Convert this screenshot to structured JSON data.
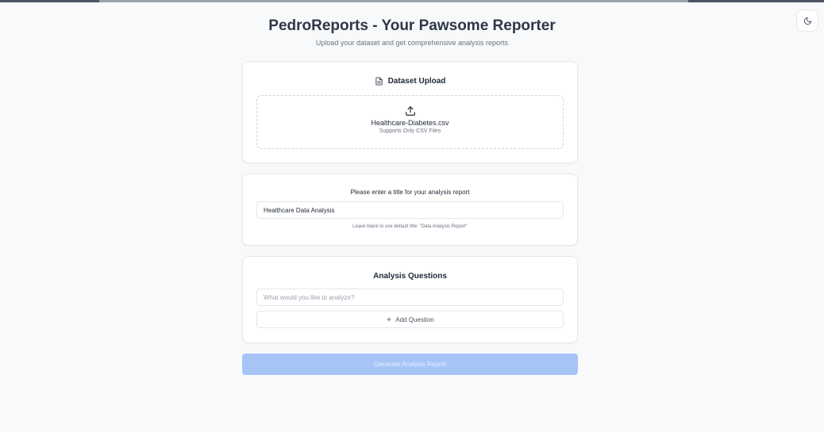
{
  "app": {
    "title": "PedroReports - Your Pawsome Reporter",
    "subtitle": "Upload your dataset and get comprehensive analysis reports"
  },
  "theme_toggle": {
    "icon": "moon-icon"
  },
  "upload": {
    "heading": "Dataset Upload",
    "heading_icon": "file-text-icon",
    "dropzone_icon": "upload-icon",
    "file_name": "Healthcare-Diabetes.csv",
    "hint": "Supports Only CSV Files"
  },
  "report_title": {
    "label": "Please enter a title for your analysis report",
    "value": "Healthcare Data Analysis",
    "help": "Leave blank to use default title: \"Data Analysis Report\""
  },
  "questions": {
    "heading": "Analysis Questions",
    "placeholder": "What would you like to analyze?",
    "add_label": "Add Question",
    "add_icon": "plus-icon"
  },
  "generate": {
    "label": "Generate Analysis Report",
    "disabled": true
  },
  "colors": {
    "page_bg": "#f8f9fb",
    "title_text": "#2d3748",
    "button_disabled_bg": "#a7c4f7"
  }
}
